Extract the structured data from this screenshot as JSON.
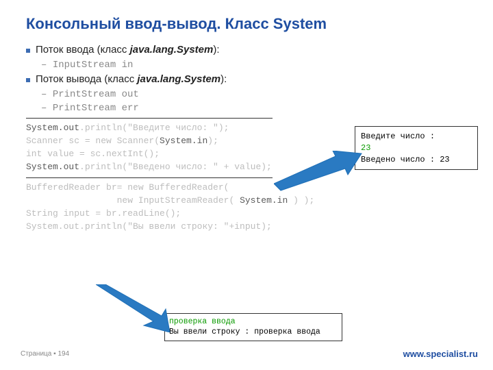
{
  "title": "Консольный ввод-вывод. Класс System",
  "bullets": {
    "b1_pre": "Поток ввода (класс ",
    "b1_em": "java.lang.System",
    "b1_post": "):",
    "b1_sub1": "InputStream in",
    "b2_pre": "Поток вывода (класс ",
    "b2_em": "java.lang.System",
    "b2_post": "):",
    "b2_sub1": "PrintStream out",
    "b2_sub2": "PrintStream err"
  },
  "code1": {
    "l1a": "System.out",
    "l1b": ".println(\"Введите число: \");",
    "l2a": "Scanner sc = new Scanner(",
    "l2b": "System.in",
    "l2c": ");",
    "l3": "int value = sc.nextInt();",
    "l4a": "System.out",
    "l4b": ".println(\"Введено число: \" + value);"
  },
  "code2": {
    "l1": "BufferedReader br= new BufferedReader(",
    "l2a": "                 new InputStreamReader( ",
    "l2b": "System.in",
    "l2c": " ) );",
    "l3": "String input = br.readLine();",
    "l4": "System.out.println(\"Вы ввели строку: \"+input);"
  },
  "console1": {
    "l1": "Введите число :",
    "l2": "23",
    "l3": "Введено число : 23"
  },
  "console2": {
    "l1": "проверка ввода",
    "l2": "Вы ввели строку : проверка ввода"
  },
  "footer": {
    "page_label": "Страница ",
    "page_sep": "▪ ",
    "page_num": "194",
    "site": "www.specialist.ru"
  }
}
